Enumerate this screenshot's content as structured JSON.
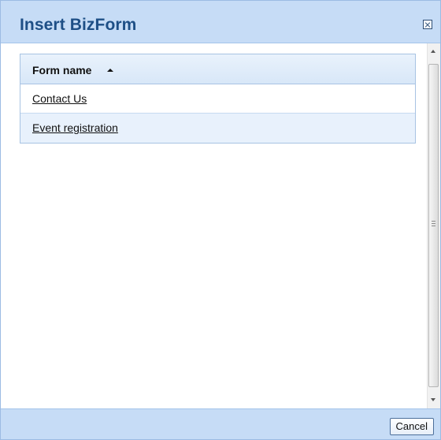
{
  "dialog": {
    "title": "Insert BizForm",
    "close_icon": "close-box-icon"
  },
  "grid": {
    "column_header": "Form name",
    "sort_icon": "sort-ascending-icon",
    "rows": [
      {
        "name": "Contact Us"
      },
      {
        "name": "Event registration"
      }
    ]
  },
  "footer": {
    "cancel_label": "Cancel"
  },
  "colors": {
    "titlebar_bg": "#c6dcf6",
    "title_text": "#1e4f86",
    "alt_row_bg": "#e8f1fc"
  }
}
